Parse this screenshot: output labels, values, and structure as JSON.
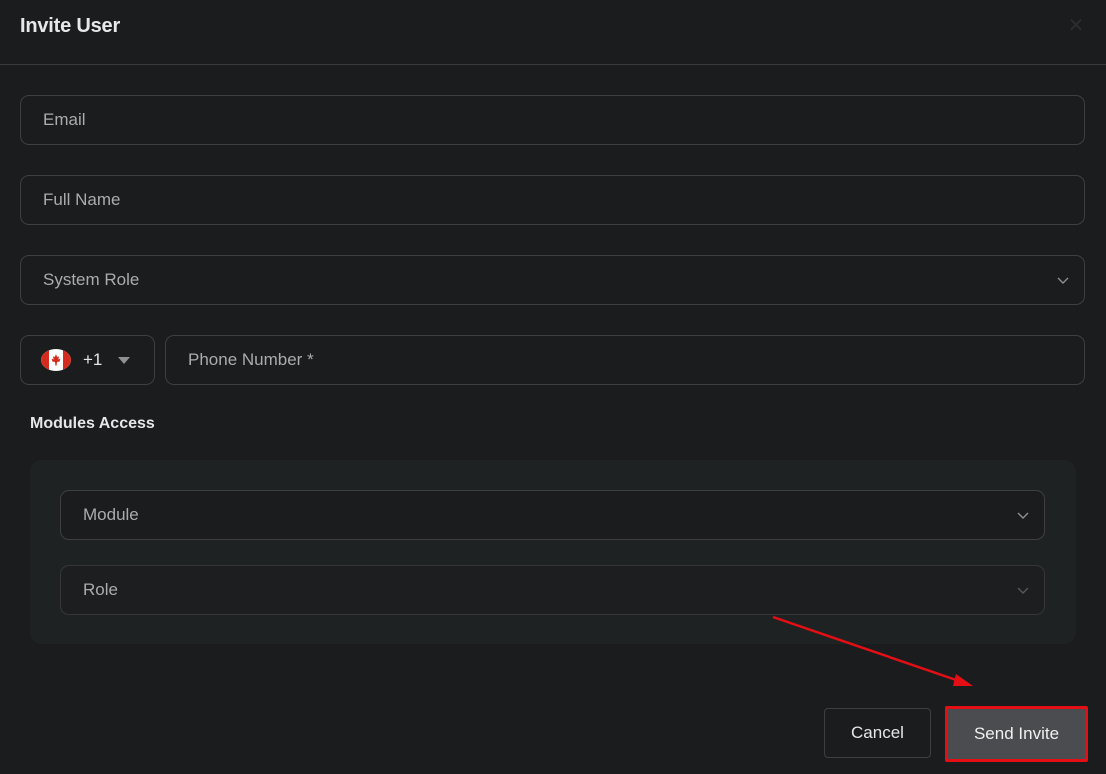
{
  "dialog": {
    "title": "Invite User",
    "close_icon": "close-icon"
  },
  "form": {
    "email_placeholder": "Email",
    "full_name_placeholder": "Full Name",
    "system_role_placeholder": "System Role",
    "country_flag": "canada-flag-icon",
    "country_code": "+1",
    "phone_placeholder": "Phone Number *"
  },
  "modules": {
    "section_label": "Modules Access",
    "module_placeholder": "Module",
    "role_placeholder": "Role"
  },
  "footer": {
    "cancel_label": "Cancel",
    "send_label": "Send Invite"
  },
  "annotation": {
    "highlight_color": "#e30f14"
  }
}
